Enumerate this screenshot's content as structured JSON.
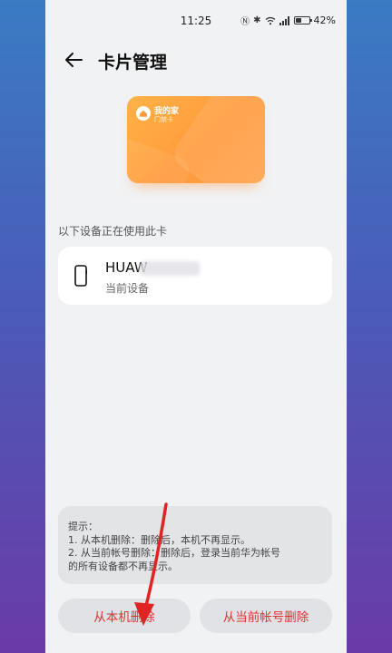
{
  "status_bar": {
    "time": "11:25",
    "battery": "42%",
    "battery_level": 0.42
  },
  "header": {
    "title": "卡片管理"
  },
  "card": {
    "title": "我的家",
    "subtitle": "门禁卡"
  },
  "devices_section": {
    "label": "以下设备正在使用此卡",
    "devices": [
      {
        "name": "HUAW",
        "status": "当前设备"
      }
    ]
  },
  "tips": {
    "lines": [
      "提示：",
      "1. 从本机删除：删除后，本机不再显示。",
      "2. 从当前帐号删除：删除后，登录当前华为帐号",
      "的所有设备都不再显示。"
    ]
  },
  "actions": {
    "delete_local": "从本机删除",
    "delete_account": "从当前帐号删除"
  },
  "colors": {
    "accent_red": "#e0312f",
    "card_orange": "#ff9a3c"
  }
}
